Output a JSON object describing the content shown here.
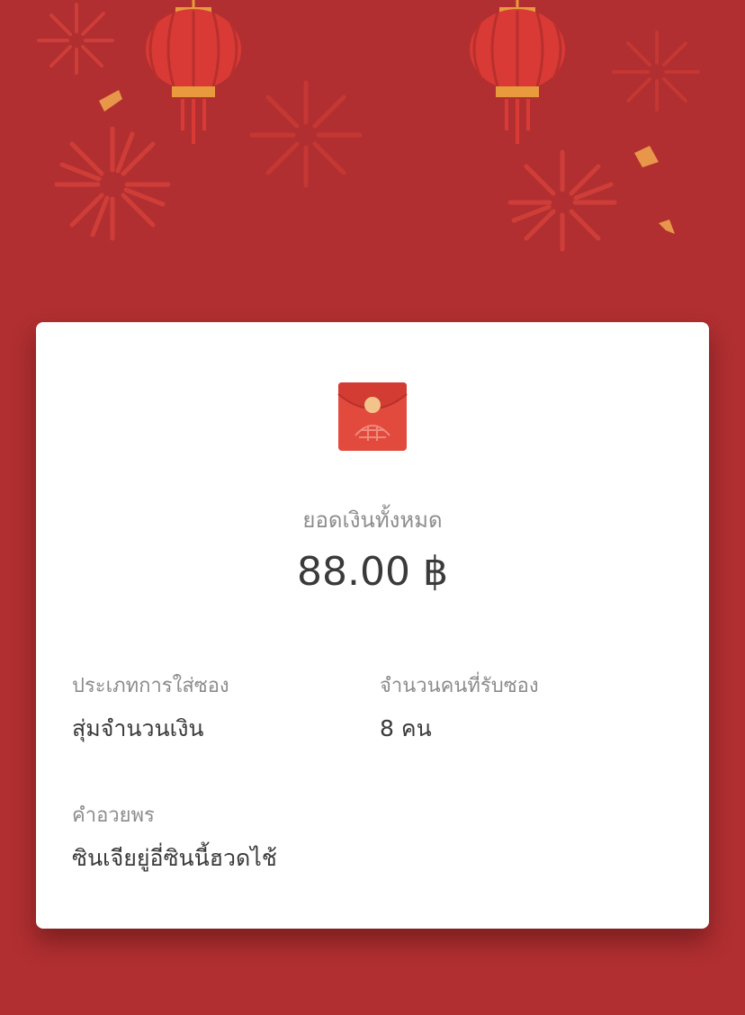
{
  "theme": {
    "background": "#b12f31",
    "card": "#ffffff",
    "accent": "#e24a3d",
    "gold": "#f0c08a"
  },
  "decorations": [
    "firework-icon",
    "lantern-icon",
    "confetti-icon"
  ],
  "envelope_icon": "red-envelope-icon",
  "summary": {
    "total_label": "ยอดเงินทั้งหมด",
    "total_amount": "88.00 ฿"
  },
  "details": {
    "type_label": "ประเภทการใส่ซอง",
    "type_value": "สุ่มจำนวนเงิน",
    "recipients_label": "จำนวนคนที่รับซอง",
    "recipients_value": "8 คน",
    "message_label": "คำอวยพร",
    "message_value": "ซินเจียยู่อี่ซินนี้ฮวดไช้"
  }
}
